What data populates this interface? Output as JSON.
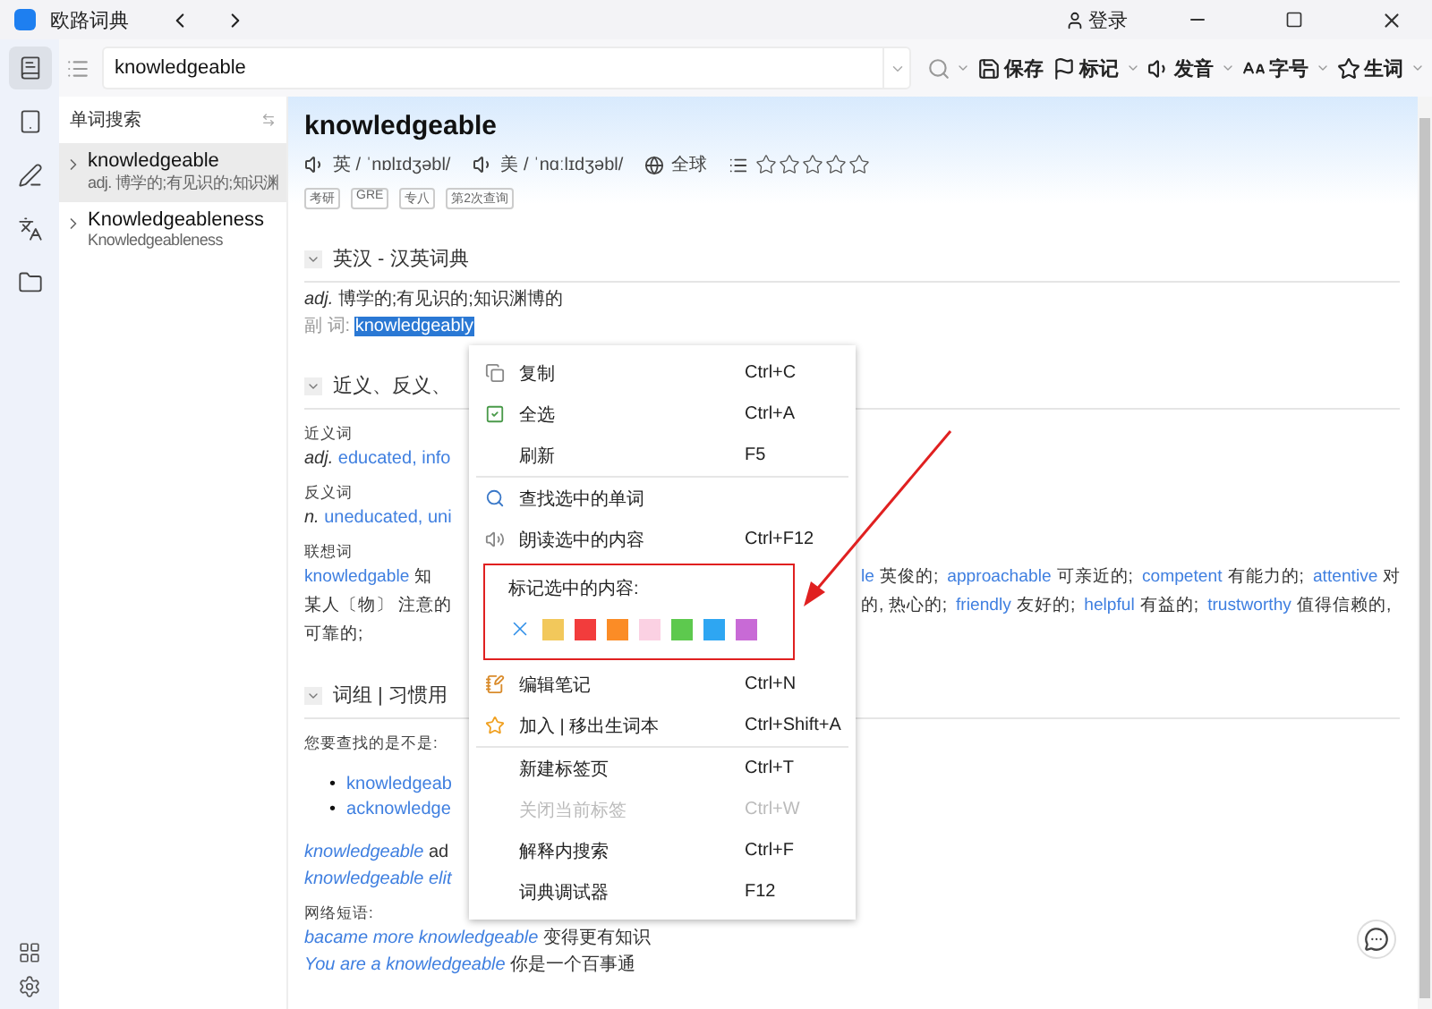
{
  "window": {
    "title": "欧路词典",
    "login": "登录"
  },
  "rail": {
    "items": [
      {
        "selected": true
      },
      {
        "selected": false
      },
      {
        "selected": false
      },
      {
        "selected": false
      },
      {
        "selected": false
      }
    ]
  },
  "search": {
    "value": "knowledgeable"
  },
  "toolbar": [
    {
      "label": "保存",
      "dropdown": false
    },
    {
      "label": "标记",
      "dropdown": true
    },
    {
      "label": "发音",
      "dropdown": true
    },
    {
      "label": "字号",
      "dropdown": true
    },
    {
      "label": "生词",
      "dropdown": true
    }
  ],
  "sidebar": {
    "title": "单词搜索",
    "items": [
      {
        "word": "knowledgeable",
        "desc": "adj. 博学的;有见识的;知识渊",
        "selected": true,
        "expanded": false
      },
      {
        "word": "Knowledgeableness",
        "desc": "Knowledgeableness",
        "selected": false,
        "expanded": false
      }
    ]
  },
  "entry": {
    "word": "knowledgeable",
    "pronunciations": [
      "英 / ˈnɒlɪdʒəbl/",
      "美 / ˈnɑːlɪdʒəbl/"
    ],
    "region": "全球",
    "stars": 0,
    "tags": [
      "考研",
      "GRE",
      "专八",
      "第2次查询"
    ]
  },
  "sections": [
    {
      "title": "英汉 - 汉英词典",
      "expanded": true,
      "lines": [
        {
          "kind": "def",
          "pos": "adj.",
          "text": "博学的;有见识的;知识渊博的"
        },
        {
          "kind": "derived",
          "label": "副 词:",
          "word": "knowledgeably",
          "selected": true
        }
      ]
    },
    {
      "title": "近义、反义、",
      "expanded": true,
      "lines": [
        {
          "kind": "caption",
          "text": "近义词"
        },
        {
          "kind": "words",
          "pos": "adj.",
          "words": [
            "educated",
            "info"
          ],
          "separator": ", "
        },
        {
          "kind": "caption",
          "text": "反义词"
        },
        {
          "kind": "words",
          "pos": "n.",
          "words": [
            "uneducated",
            "uni"
          ],
          "separator": ", "
        },
        {
          "kind": "caption",
          "text": "联想词"
        },
        {
          "kind": "split",
          "left": [
            {
              "text": "knowledgable",
              "link": true
            },
            {
              "text": "知",
              "link": false
            }
          ],
          "right": [
            {
              "text": "le",
              "link": true
            },
            {
              "text": "英俊的;",
              "link": false
            },
            {
              "text": "approachable",
              "link": true
            },
            {
              "text": "可亲近的;",
              "link": false
            },
            {
              "text": "competent",
              "link": true
            },
            {
              "text": "有能力的;",
              "link": false
            },
            {
              "text": "attentive",
              "link": true
            },
            {
              "text": "对",
              "link": false
            }
          ]
        },
        {
          "kind": "split",
          "left": [
            {
              "text": "某人〔物〕 注意的",
              "link": false
            }
          ],
          "right": [
            {
              "text": "的, 热心的;",
              "link": false
            },
            {
              "text": "friendly",
              "link": true
            },
            {
              "text": "友好的;",
              "link": false
            },
            {
              "text": "helpful",
              "link": true
            },
            {
              "text": "有益的;",
              "link": false
            },
            {
              "text": "trustworthy",
              "link": true
            },
            {
              "text": "值得信赖的,",
              "link": false
            }
          ]
        },
        {
          "kind": "split",
          "left": [
            {
              "text": "可靠的;",
              "link": false
            }
          ]
        }
      ]
    },
    {
      "title": "词组 | 习惯用",
      "expanded": true,
      "lines": [
        {
          "kind": "caption",
          "text": "您要查找的是不是:"
        },
        {
          "kind": "bullets",
          "marker": "•",
          "items": [
            "knowledgeab",
            "acknowledge"
          ]
        },
        {
          "kind": "phrase",
          "phrase": "knowledgeable",
          "meaning": "ad"
        },
        {
          "kind": "phrase",
          "phrase": "knowledgeable elit"
        },
        {
          "kind": "caption",
          "text": "网络短语:"
        },
        {
          "kind": "phrase",
          "phrase": "bacame more knowledgeable",
          "meaning": "变得更有知识"
        },
        {
          "kind": "phrase",
          "phrase": "You are a knowledgeable",
          "meaning": "你是一个百事通"
        }
      ]
    }
  ],
  "menu": [
    {
      "kind": "item",
      "label": "复制",
      "shortcut": "Ctrl+C",
      "disabled": false
    },
    {
      "kind": "item",
      "label": "全选",
      "shortcut": "Ctrl+A",
      "disabled": false
    },
    {
      "kind": "item",
      "label": "刷新",
      "shortcut": "F5",
      "disabled": false
    },
    {
      "kind": "divider"
    },
    {
      "kind": "item",
      "label": "查找选中的单词",
      "disabled": false
    },
    {
      "kind": "item",
      "label": "朗读选中的内容",
      "shortcut": "Ctrl+F12",
      "disabled": false
    },
    {
      "kind": "palette",
      "label": "标记选中的内容:",
      "colors": [
        {
          "color": "#f2c85b"
        },
        {
          "color": "#f23c3c"
        },
        {
          "color": "#fb8c26"
        },
        {
          "color": "#fbd1e3"
        },
        {
          "color": "#5dc94e"
        },
        {
          "color": "#2ea6f2"
        },
        {
          "color": "#c86ad6"
        }
      ]
    },
    {
      "kind": "item",
      "label": "编辑笔记",
      "shortcut": "Ctrl+N",
      "disabled": false
    },
    {
      "kind": "item",
      "label": "加入 | 移出生词本",
      "shortcut": "Ctrl+Shift+A",
      "disabled": false
    },
    {
      "kind": "divider"
    },
    {
      "kind": "item",
      "label": "新建标签页",
      "shortcut": "Ctrl+T",
      "disabled": false
    },
    {
      "kind": "item",
      "label": "关闭当前标签",
      "shortcut": "Ctrl+W",
      "disabled": true
    },
    {
      "kind": "item",
      "label": "解释内搜索",
      "shortcut": "Ctrl+F",
      "disabled": false
    },
    {
      "kind": "item",
      "label": "词典调试器",
      "shortcut": "F12",
      "disabled": false
    }
  ]
}
